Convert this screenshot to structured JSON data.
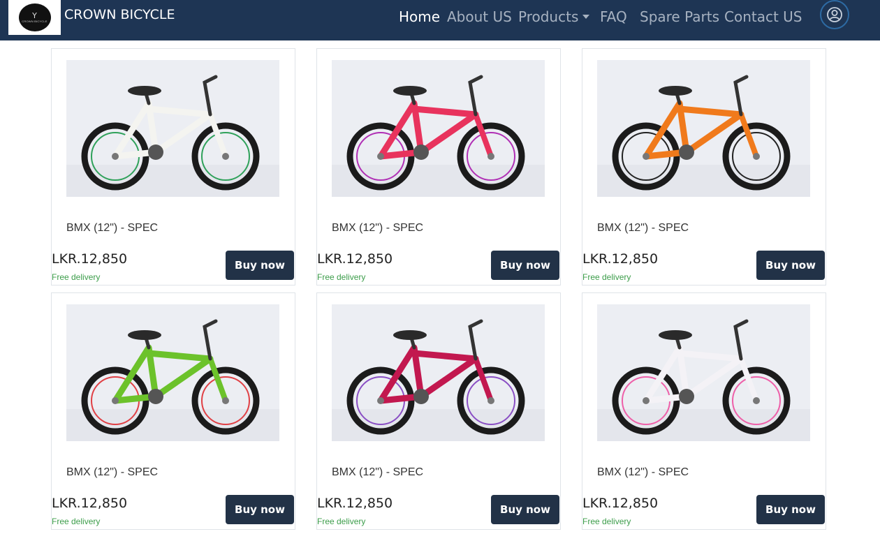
{
  "brand": {
    "name": "CROWN BICYCLE",
    "logo_text": "CROWN BICYCLE"
  },
  "nav": {
    "items": [
      {
        "label": "Home",
        "active": true
      },
      {
        "label": "About US"
      },
      {
        "label": "Products",
        "dropdown": true
      },
      {
        "label": "FAQ"
      },
      {
        "label": "Spare Parts"
      },
      {
        "label": "Contact US"
      }
    ],
    "user_icon": "user-circle-icon"
  },
  "products": [
    {
      "name": "BMX (12\") - SPEC",
      "price": "LKR.12,850",
      "delivery": "Free delivery",
      "button": "Buy now",
      "frame_color": "#f4f4f0",
      "accent": "#2fa15a"
    },
    {
      "name": "BMX (12\") - SPEC",
      "price": "LKR.12,850",
      "delivery": "Free delivery",
      "button": "Buy now",
      "frame_color": "#e8335d",
      "accent": "#b02fb5"
    },
    {
      "name": "BMX (12\") - SPEC",
      "price": "LKR.12,850",
      "delivery": "Free delivery",
      "button": "Buy now",
      "frame_color": "#f07a1c",
      "accent": "#222222"
    },
    {
      "name": "BMX (12\") - SPEC",
      "price": "LKR.12,850",
      "delivery": "Free delivery",
      "button": "Buy now",
      "frame_color": "#6cc22b",
      "accent": "#e04045"
    },
    {
      "name": "BMX (12\") - SPEC",
      "price": "LKR.12,850",
      "delivery": "Free delivery",
      "button": "Buy now",
      "frame_color": "#c2184f",
      "accent": "#8a4fc4"
    },
    {
      "name": "BMX (12\") - SPEC",
      "price": "LKR.12,850",
      "delivery": "Free delivery",
      "button": "Buy now",
      "frame_color": "#f4f2f6",
      "accent": "#ee5fa8"
    }
  ],
  "colors": {
    "navbar": "#1e3554",
    "button": "#223247",
    "delivery": "#3c9d4a"
  }
}
